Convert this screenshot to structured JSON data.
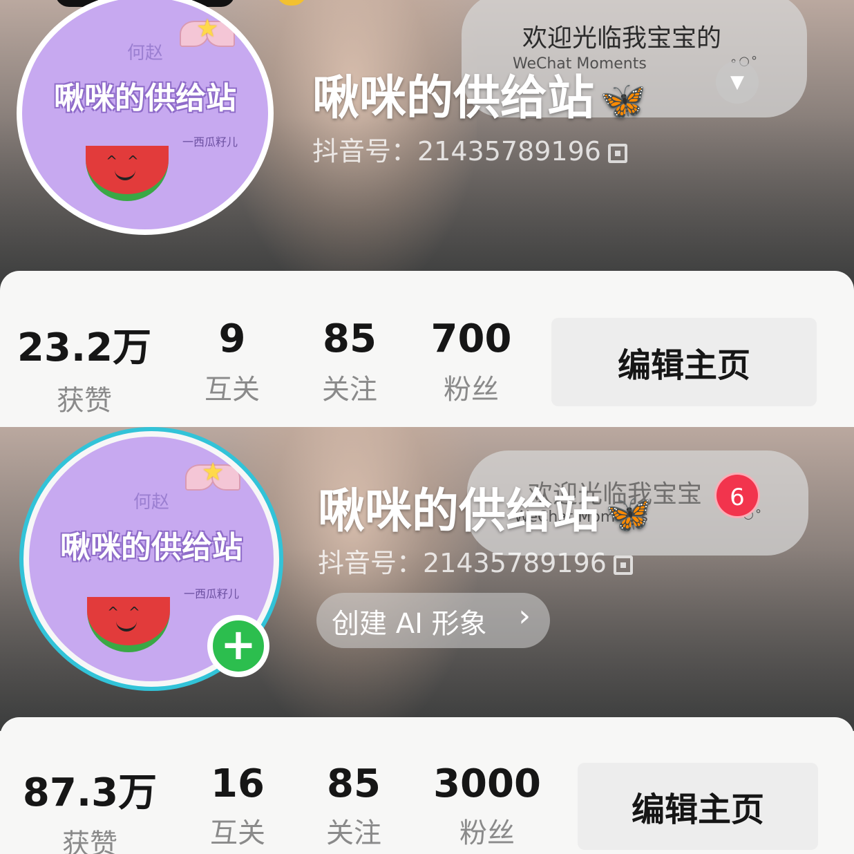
{
  "profiles": [
    {
      "avatar": {
        "top_text": "何赵",
        "name_text": "啾咪的供给站",
        "sig_text": "一西瓜籽儿"
      },
      "nickname": "啾咪的供给站",
      "douyin_id": "抖音号：21435789196",
      "bubble": {
        "text": "欢迎光临我宝宝的",
        "sub": "WeChat Moments"
      },
      "stats": [
        {
          "value": "23.2万",
          "label": "获赞"
        },
        {
          "value": "9",
          "label": "互关"
        },
        {
          "value": "85",
          "label": "关注"
        },
        {
          "value": "700",
          "label": "粉丝"
        }
      ],
      "edit_button": "编辑主页"
    },
    {
      "avatar": {
        "top_text": "何赵",
        "name_text": "啾咪的供给站",
        "sig_text": "一西瓜籽儿"
      },
      "nickname": "啾咪的供给站",
      "douyin_id": "抖音号：21435789196",
      "bubble": {
        "text": "欢迎光临我宝宝",
        "sub": "WeChat Moments"
      },
      "notification_count": "6",
      "ai_button": "创建 AI 形象",
      "stats": [
        {
          "value": "87.3万",
          "label": "获赞"
        },
        {
          "value": "16",
          "label": "互关"
        },
        {
          "value": "85",
          "label": "关注"
        },
        {
          "value": "3000",
          "label": "粉丝"
        }
      ],
      "edit_button": "编辑主页"
    }
  ],
  "icons": {
    "butterfly": "butterfly-icon",
    "qr": "qr-code-icon",
    "dropdown": "chevron-down-icon",
    "chevron_right": "chevron-right-icon",
    "plus": "plus-icon"
  },
  "colors": {
    "accent_green": "#2cbe4e",
    "ring_cyan": "#32c3d8",
    "badge_red": "#f2344d",
    "avatar_purple": "#c7a9f0"
  }
}
